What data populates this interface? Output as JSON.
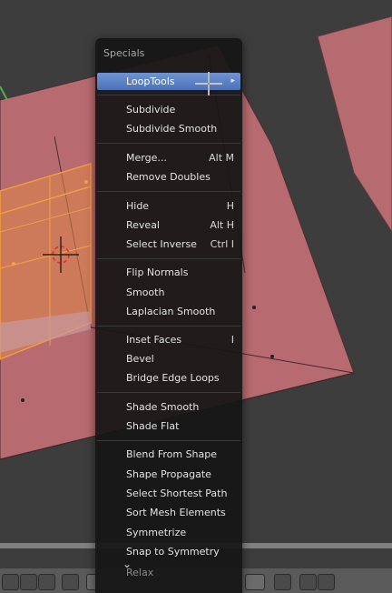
{
  "menu": {
    "title": "Specials",
    "items": [
      {
        "label": "LoopTools",
        "shortcut": ""
      },
      {
        "label": "Subdivide",
        "shortcut": ""
      },
      {
        "label": "Subdivide Smooth",
        "shortcut": ""
      },
      {
        "label": "Merge...",
        "shortcut": "Alt M"
      },
      {
        "label": "Remove Doubles",
        "shortcut": ""
      },
      {
        "label": "Hide",
        "shortcut": "H"
      },
      {
        "label": "Reveal",
        "shortcut": "Alt H"
      },
      {
        "label": "Select Inverse",
        "shortcut": "Ctrl I"
      },
      {
        "label": "Flip Normals",
        "shortcut": ""
      },
      {
        "label": "Smooth",
        "shortcut": ""
      },
      {
        "label": "Laplacian Smooth",
        "shortcut": ""
      },
      {
        "label": "Inset Faces",
        "shortcut": "I"
      },
      {
        "label": "Bevel",
        "shortcut": ""
      },
      {
        "label": "Bridge Edge Loops",
        "shortcut": ""
      },
      {
        "label": "Shade Smooth",
        "shortcut": ""
      },
      {
        "label": "Shade Flat",
        "shortcut": ""
      },
      {
        "label": "Blend From Shape",
        "shortcut": ""
      },
      {
        "label": "Shape Propagate",
        "shortcut": ""
      },
      {
        "label": "Select Shortest Path",
        "shortcut": ""
      },
      {
        "label": "Sort Mesh Elements",
        "shortcut": ""
      },
      {
        "label": "Symmetrize",
        "shortcut": ""
      },
      {
        "label": "Snap to Symmetry",
        "shortcut": ""
      },
      {
        "label": "Relax",
        "shortcut": ""
      }
    ]
  },
  "colors": {
    "viewport_bg": "#3c3c3c",
    "face": "#b86a6f",
    "selected": "#f08a2a",
    "menu_highlight": "#5f86c8"
  },
  "icons": [
    "cursor-crosshair-icon",
    "3d-cursor-icon",
    "chevron-down-icon",
    "submenu-arrow-icon"
  ]
}
